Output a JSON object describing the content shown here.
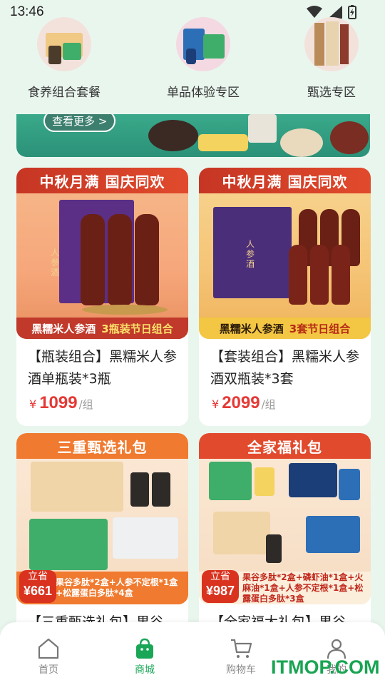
{
  "status": {
    "time": "13:46"
  },
  "categories": [
    {
      "label": "食养组合套餐"
    },
    {
      "label": "单品体验专区"
    },
    {
      "label": "甄选专区"
    }
  ],
  "banner": {
    "more_label": "查看更多 >"
  },
  "products": [
    {
      "ribbon": "中秋月满  国庆同欢",
      "strip_left": "黑糯米人参酒",
      "strip_right": "3瓶装节日组合",
      "bottle_label": "人参酒",
      "title": "【瓶装组合】黑糯米人参酒单瓶装*3瓶",
      "currency": "¥",
      "price": "1099",
      "unit": "/组"
    },
    {
      "ribbon": "中秋月满  国庆同欢",
      "strip_left": "黑糯米人参酒",
      "strip_right": "3套节日组合",
      "bottle_label": "人参酒",
      "title": "【套装组合】黑糯米人参酒双瓶装*3套",
      "currency": "¥",
      "price": "2099",
      "unit": "/组"
    },
    {
      "ribbon": "三重甄选礼包",
      "save_label": "立省",
      "save_amount": "¥661",
      "detail": "果谷多肽*2盒+人参不定根*1盒+松露蛋白多肽*4盒",
      "title": "【三重甄选礼包】果谷"
    },
    {
      "ribbon": "全家福礼包",
      "save_label": "立省",
      "save_amount": "¥987",
      "detail": "果谷多肽*2盒+磷虾油*1盒+火麻油*1盒+人参不定根*1盒+松露蛋白多肽*3盒",
      "title": "【全家福大礼包】果谷"
    }
  ],
  "tabbar": {
    "items": [
      {
        "label": "首页"
      },
      {
        "label": "商城"
      },
      {
        "label": "购物车"
      },
      {
        "label": "我的"
      }
    ],
    "active_color": "#1aa657"
  },
  "watermark": "ITMOP.COM"
}
